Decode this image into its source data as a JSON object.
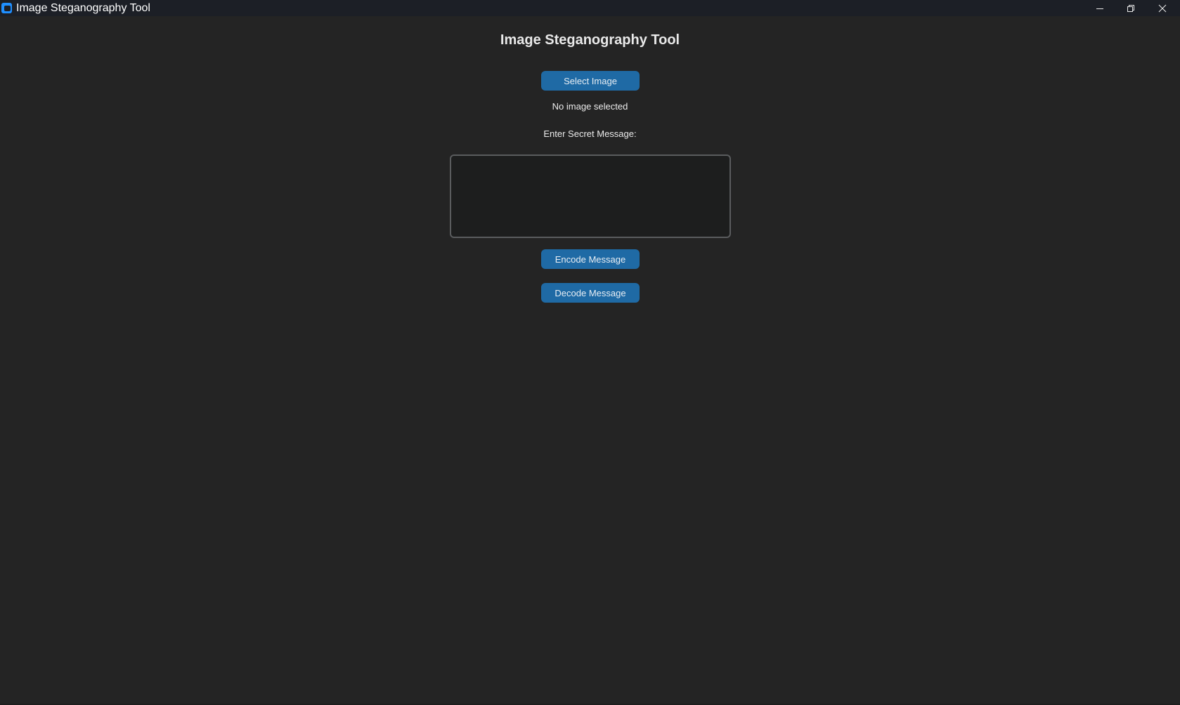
{
  "window": {
    "title": "Image Steganography Tool",
    "icon": "app-window-icon",
    "controls": {
      "minimize_icon": "minimize-icon",
      "maximize_icon": "restore-icon",
      "close_icon": "close-icon"
    }
  },
  "main": {
    "heading": "Image Steganography Tool",
    "select_button_label": "Select Image",
    "image_status": "No image selected",
    "message_label": "Enter Secret Message:",
    "message_value": "",
    "encode_button_label": "Encode Message",
    "decode_button_label": "Decode Message"
  },
  "colors": {
    "background": "#242424",
    "titlebar": "#1c1f26",
    "button": "#1f6aa5",
    "textbox_bg": "#1d1e1e",
    "textbox_border": "#5a5c5e",
    "accent_icon": "#1f8fff"
  }
}
